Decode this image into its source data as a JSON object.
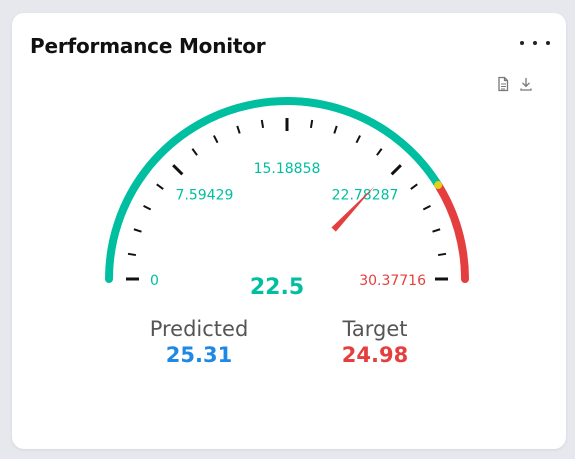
{
  "title": "Performance Monitor",
  "toolbar": {
    "icons": [
      "document-icon",
      "download-icon"
    ]
  },
  "gauge": {
    "value": 22.5,
    "value_label": "22.5",
    "min": 0,
    "max": 30.37716,
    "tick_labels": [
      "0",
      "7.59429",
      "15.18858",
      "22.78287",
      "30.37716"
    ],
    "warning_threshold": 25.0,
    "colors": {
      "normal": "#00bfa0",
      "warning": "#e53e3e",
      "marker": "#e0d018",
      "needle": "#e53e3e",
      "value_text": "#00bfa0",
      "tick": "#111111"
    }
  },
  "stats": {
    "predicted_label": "Predicted",
    "predicted_value": "25.31",
    "target_label": "Target",
    "target_value": "24.98",
    "predicted_color": "#1e88e5",
    "target_color": "#e53e3e"
  }
}
